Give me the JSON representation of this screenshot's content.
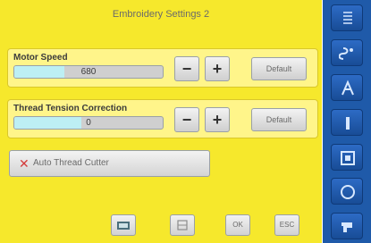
{
  "screen": {
    "title": "Embroidery Settings 2"
  },
  "motor_speed": {
    "label": "Motor Speed",
    "value": "680",
    "minus": "−",
    "plus": "+",
    "default": "Default",
    "fill_fraction": 0.34
  },
  "thread_tension": {
    "label": "Thread Tension Correction",
    "value": "0",
    "minus": "−",
    "plus": "+",
    "default": "Default",
    "fill_fraction": 0.45
  },
  "auto_thread_cutter": {
    "label": "Auto Thread Cutter",
    "status_icon": "red-x-icon"
  },
  "bottom_buttons": [
    {
      "name": "embroidery-icon",
      "label": ""
    },
    {
      "name": "bobbin-icon",
      "label": ""
    },
    {
      "name": "ok-button",
      "label": "OK"
    },
    {
      "name": "esc-button",
      "label": "ESC"
    }
  ],
  "sidebar": {
    "items": [
      {
        "name": "stitch-length-icon",
        "glyph": "≡"
      },
      {
        "name": "stitch-pattern-icon",
        "glyph": "§"
      },
      {
        "name": "font-icon",
        "glyph": "A"
      },
      {
        "name": "needle-icon",
        "glyph": "|"
      },
      {
        "name": "hoop-icon",
        "glyph": "▣"
      },
      {
        "name": "record-icon",
        "glyph": "◎"
      },
      {
        "name": "machine-icon",
        "glyph": "⌂"
      }
    ]
  },
  "colors": {
    "background_yellow": "#f6e82c",
    "panel_yellow": "#fff58a",
    "sidebar_blue": "#1f5aa9",
    "value_bar_fill": "#bdeff4",
    "red_x": "#d43b3b"
  }
}
